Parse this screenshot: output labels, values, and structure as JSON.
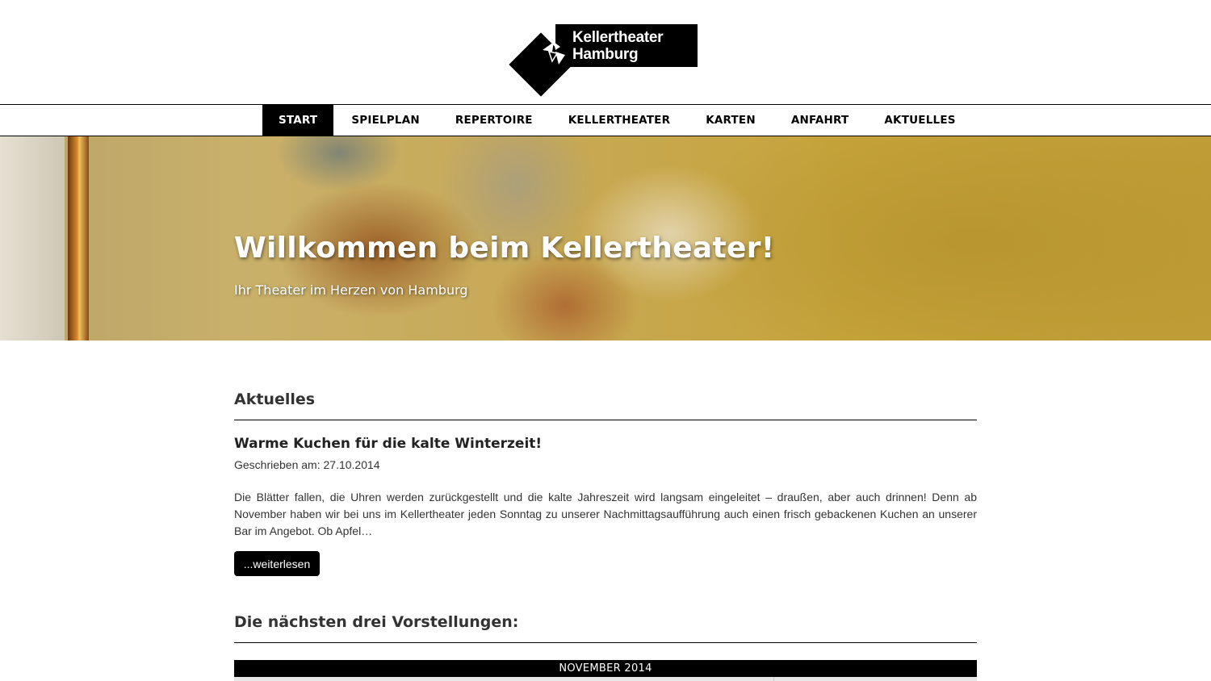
{
  "logo": {
    "line1": "Kellertheater",
    "line2": "Hamburg",
    "icon": "theater-diamond-logo"
  },
  "nav": {
    "items": [
      {
        "label": "START",
        "active": true
      },
      {
        "label": "SPIELPLAN"
      },
      {
        "label": "REPERTOIRE"
      },
      {
        "label": "KELLERTHEATER"
      },
      {
        "label": "KARTEN"
      },
      {
        "label": "ANFAHRT"
      },
      {
        "label": "AKTUELLES"
      }
    ]
  },
  "hero": {
    "title": "Willkommen beim Kellertheater!",
    "subtitle": "Ihr Theater im Herzen von Hamburg"
  },
  "news": {
    "section_title": "Aktuelles",
    "title": "Warme Kuchen für die kalte Winterzeit!",
    "date": "Geschrieben am: 27.10.2014",
    "text": "Die Blätter fallen, die Uhren werden zurückgestellt und die kalte Jahreszeit wird langsam eingeleitet – draußen, aber auch drinnen! Denn ab November haben wir bei uns im Kellertheater jeden Sonntag zu unserer Nachmittagsaufführung auch einen frisch gebackenen Kuchen an unserer Bar im Angebot. Ob Apfel…",
    "more_label": "...weiterlesen"
  },
  "performances": {
    "section_title": "Die nächsten drei Vorstellungen:",
    "month": "NOVEMBER 2014"
  },
  "colors": {
    "accent": "#000000",
    "background": "#ffffff",
    "text": "#222222"
  }
}
